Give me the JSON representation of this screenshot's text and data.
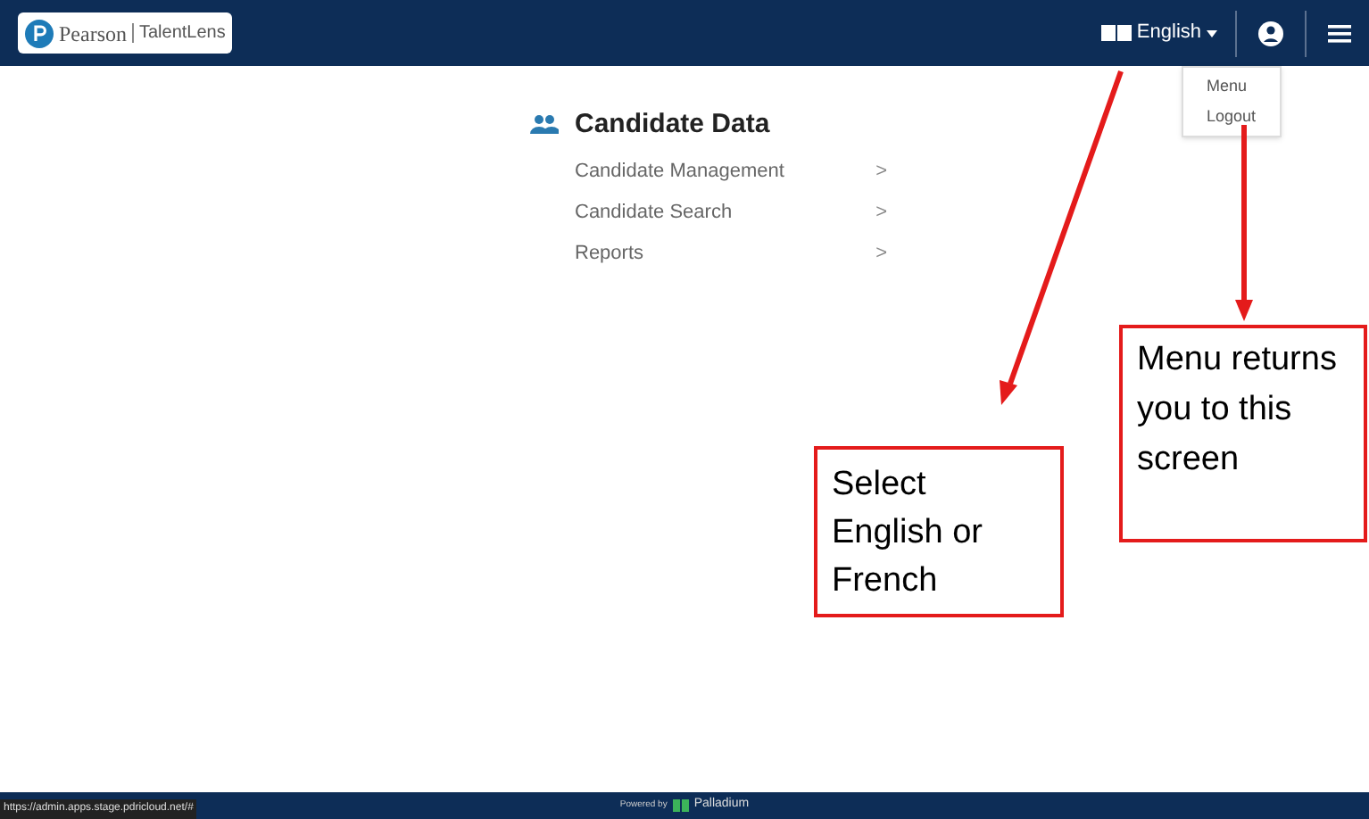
{
  "header": {
    "logo_brand": "Pearson",
    "logo_product": "TalentLens",
    "language": "English",
    "user_menu": {
      "open": true,
      "items": [
        "Menu",
        "Logout"
      ]
    }
  },
  "section": {
    "title": "Candidate Data",
    "items": [
      {
        "label": "Candidate Management",
        "chevron": ">"
      },
      {
        "label": "Candidate Search",
        "chevron": ">"
      },
      {
        "label": "Reports",
        "chevron": ">"
      }
    ]
  },
  "annotations": [
    {
      "text": "Select English or French"
    },
    {
      "text": "Menu returns you to this screen"
    }
  ],
  "footer": {
    "powered_by": "Powered by",
    "brand": "Palladium"
  },
  "status_bar": {
    "url": "https://admin.apps.stage.pdricloud.net/#"
  }
}
